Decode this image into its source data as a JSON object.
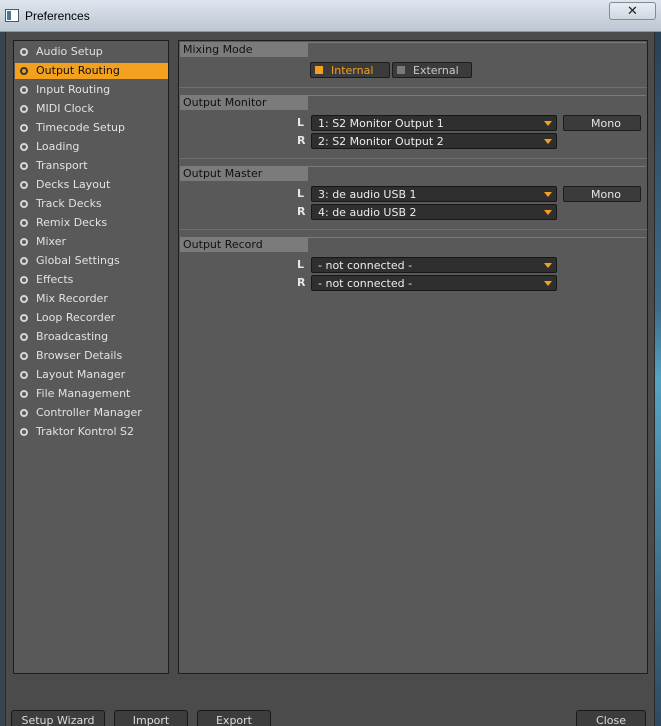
{
  "window": {
    "title": "Preferences",
    "close_glyph": "✕"
  },
  "sidebar": {
    "items": [
      {
        "label": "Audio Setup",
        "active": false
      },
      {
        "label": "Output Routing",
        "active": true
      },
      {
        "label": "Input Routing",
        "active": false
      },
      {
        "label": "MIDI Clock",
        "active": false
      },
      {
        "label": "Timecode Setup",
        "active": false
      },
      {
        "label": "Loading",
        "active": false
      },
      {
        "label": "Transport",
        "active": false
      },
      {
        "label": "Decks Layout",
        "active": false
      },
      {
        "label": "Track Decks",
        "active": false
      },
      {
        "label": "Remix Decks",
        "active": false
      },
      {
        "label": "Mixer",
        "active": false
      },
      {
        "label": "Global Settings",
        "active": false
      },
      {
        "label": "Effects",
        "active": false
      },
      {
        "label": "Mix Recorder",
        "active": false
      },
      {
        "label": "Loop Recorder",
        "active": false
      },
      {
        "label": "Broadcasting",
        "active": false
      },
      {
        "label": "Browser Details",
        "active": false
      },
      {
        "label": "Layout Manager",
        "active": false
      },
      {
        "label": "File Management",
        "active": false
      },
      {
        "label": "Controller Manager",
        "active": false
      },
      {
        "label": "Traktor Kontrol S2",
        "active": false
      }
    ]
  },
  "mixing_mode": {
    "title": "Mixing Mode",
    "internal_label": "Internal",
    "external_label": "External",
    "selected": "Internal"
  },
  "output_monitor": {
    "title": "Output Monitor",
    "left_label": "L",
    "right_label": "R",
    "left_value": "1: S2 Monitor Output 1",
    "right_value": "2: S2 Monitor Output 2",
    "mono_label": "Mono"
  },
  "output_master": {
    "title": "Output Master",
    "left_label": "L",
    "right_label": "R",
    "left_value": "3: de audio USB 1",
    "right_value": "4: de audio USB 2",
    "mono_label": "Mono"
  },
  "output_record": {
    "title": "Output Record",
    "left_label": "L",
    "right_label": "R",
    "left_value": "- not connected -",
    "right_value": "- not connected -"
  },
  "footer": {
    "setup_wizard_label": "Setup Wizard",
    "import_label": "Import",
    "export_label": "Export",
    "close_label": "Close"
  },
  "colors": {
    "accent": "#f2a01e",
    "panel": "#595959",
    "window_bg": "#4b4b4b"
  }
}
